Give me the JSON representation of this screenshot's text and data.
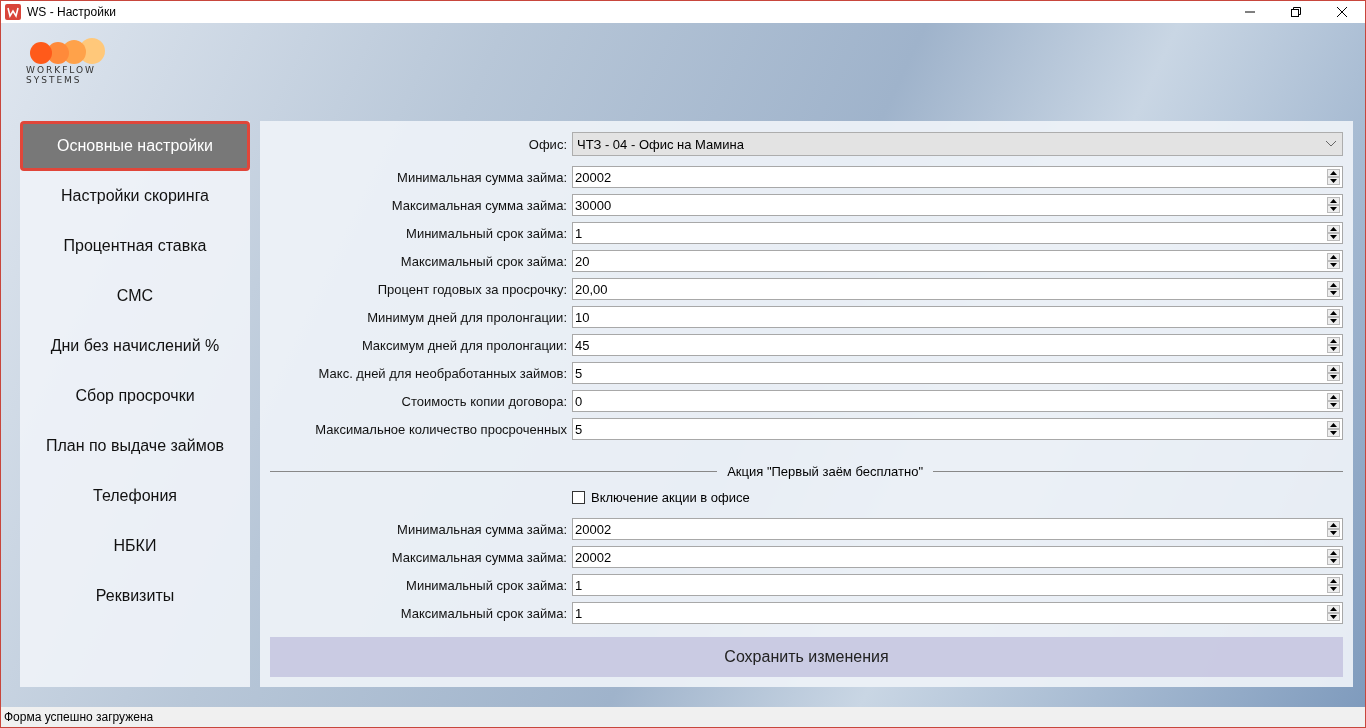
{
  "window": {
    "title": "WS - Настройки"
  },
  "logo": {
    "line_1": "WORKFLOW",
    "line_2": "SYSTEMS"
  },
  "sidebar": {
    "items": [
      {
        "label": "Основные настройки",
        "selected": true
      },
      {
        "label": "Настройки скоринга",
        "selected": false
      },
      {
        "label": "Процентная ставка",
        "selected": false
      },
      {
        "label": "СМС",
        "selected": false
      },
      {
        "label": "Дни без начислений %",
        "selected": false
      },
      {
        "label": "Сбор просрочки",
        "selected": false
      },
      {
        "label": "План по выдаче займов",
        "selected": false
      },
      {
        "label": "Телефония",
        "selected": false
      },
      {
        "label": "НБКИ",
        "selected": false
      },
      {
        "label": "Реквизиты",
        "selected": false
      }
    ]
  },
  "office": {
    "label": "Офис:",
    "value": "ЧТЗ - 04 - Офис на Мамина"
  },
  "fields": [
    {
      "label": "Минимальная сумма займа:",
      "value": "20002"
    },
    {
      "label": "Максимальная сумма займа:",
      "value": "30000"
    },
    {
      "label": "Минимальный срок займа:",
      "value": "1"
    },
    {
      "label": "Максимальный срок займа:",
      "value": "20"
    },
    {
      "label": "Процент годовых за просрочку:",
      "value": "20,00"
    },
    {
      "label": "Минимум дней для пролонгации:",
      "value": "10"
    },
    {
      "label": "Максимум дней для пролонгации:",
      "value": "45"
    },
    {
      "label": "Макс. дней для необработанных займов:",
      "value": "5"
    },
    {
      "label": "Стоимость копии договора:",
      "value": "0"
    },
    {
      "label": "Максимальное количество просроченных",
      "value": "5"
    }
  ],
  "promo": {
    "title": "Акция \"Первый заём бесплатно\"",
    "checkbox": {
      "label": "Включение акции в офисе",
      "checked": false
    },
    "fields": [
      {
        "label": "Минимальная сумма займа:",
        "value": "20002"
      },
      {
        "label": "Максимальная сумма займа:",
        "value": "20002"
      },
      {
        "label": "Минимальный срок займа:",
        "value": "1"
      },
      {
        "label": "Максимальный срок займа:",
        "value": "1"
      }
    ]
  },
  "save_button": "Сохранить изменения",
  "status_bar": "Форма успешно загружена"
}
